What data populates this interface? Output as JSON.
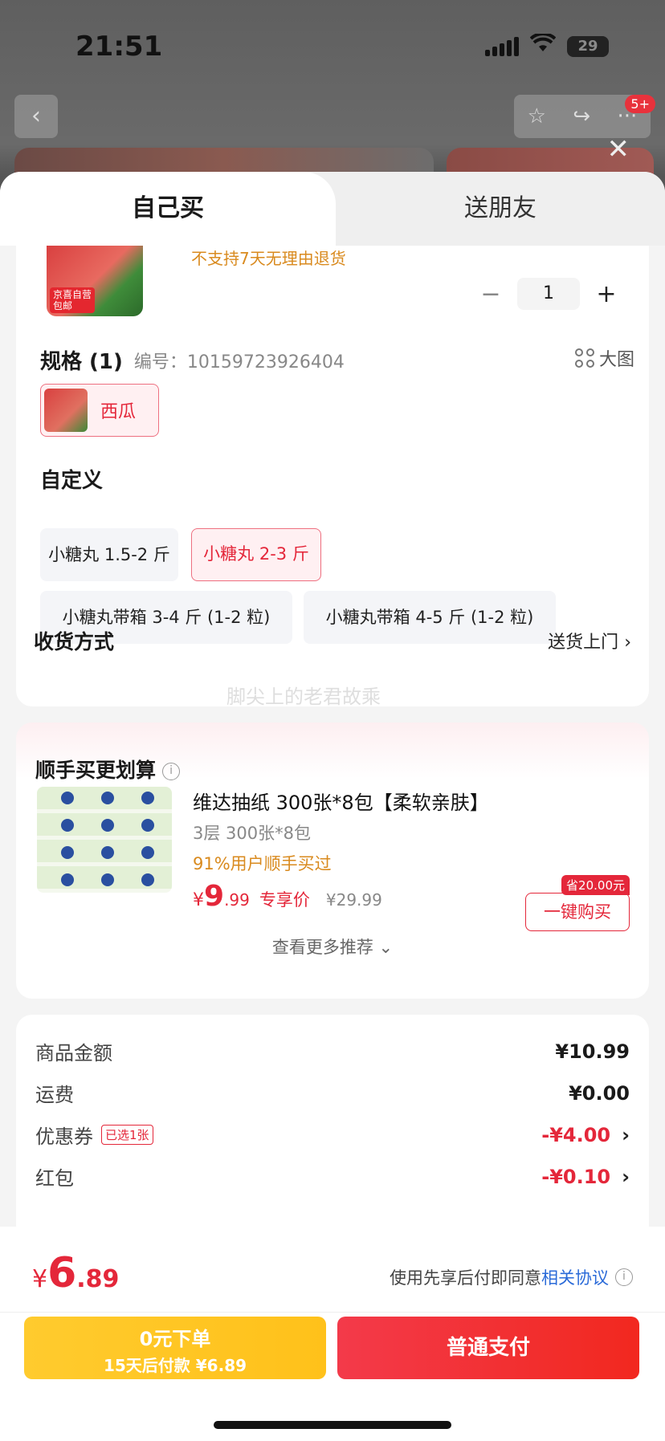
{
  "status_bar": {
    "time": "21:51",
    "battery": "29"
  },
  "topbar": {
    "badge": "5+"
  },
  "tabs": {
    "self": "自己买",
    "friend": "送朋友"
  },
  "product": {
    "image_tag_1": "京喜自营",
    "image_tag_2": "包邮",
    "notice": "不支持7天无理由退货",
    "quantity": "1"
  },
  "spec": {
    "title": "规格 (1)",
    "number": "编号：10159723926404",
    "big_view": "大图",
    "chip_label": "西瓜"
  },
  "custom": {
    "title": "自定义",
    "options": [
      "小糖丸 1.5-2 斤",
      "小糖丸 2-3 斤",
      "小糖丸带箱 3-4 斤 (1-2 粒)",
      "小糖丸带箱 4-5 斤 (1-2 粒)"
    ],
    "selected": "小糖丸 2-3 斤"
  },
  "delivery": {
    "label": "收货方式",
    "value": "送货上门"
  },
  "watermark": "脚尖上的老君故乘",
  "recommend": {
    "title": "顺手买更划算",
    "name": "维达抽纸 300张*8包【柔软亲肤】",
    "spec": "3层 300张*8包",
    "percent": "91%用户顺手买过",
    "price_symbol": "¥",
    "price_int": "9",
    "price_dec": ".99",
    "price_label": "专享价",
    "old_price": "¥29.99",
    "save_tag": "省20.00元",
    "buy_button": "一键购买",
    "more": "查看更多推荐"
  },
  "summary": {
    "goods_label": "商品金额",
    "goods_value": "¥10.99",
    "shipping_label": "运费",
    "shipping_value": "¥0.00",
    "coupon_label": "优惠券",
    "coupon_pill": "已选1张",
    "coupon_value": "-¥4.00",
    "redpack_label": "红包",
    "redpack_value": "-¥0.10"
  },
  "footer": {
    "total_symbol": "¥",
    "total_int": "6",
    "total_dec": ".89",
    "agree_text": "使用先享后付即同意",
    "agree_link": "相关协议",
    "pay_later_main": "0元下单",
    "pay_later_sub": "15天后付款 ¥6.89",
    "pay_normal": "普通支付"
  }
}
